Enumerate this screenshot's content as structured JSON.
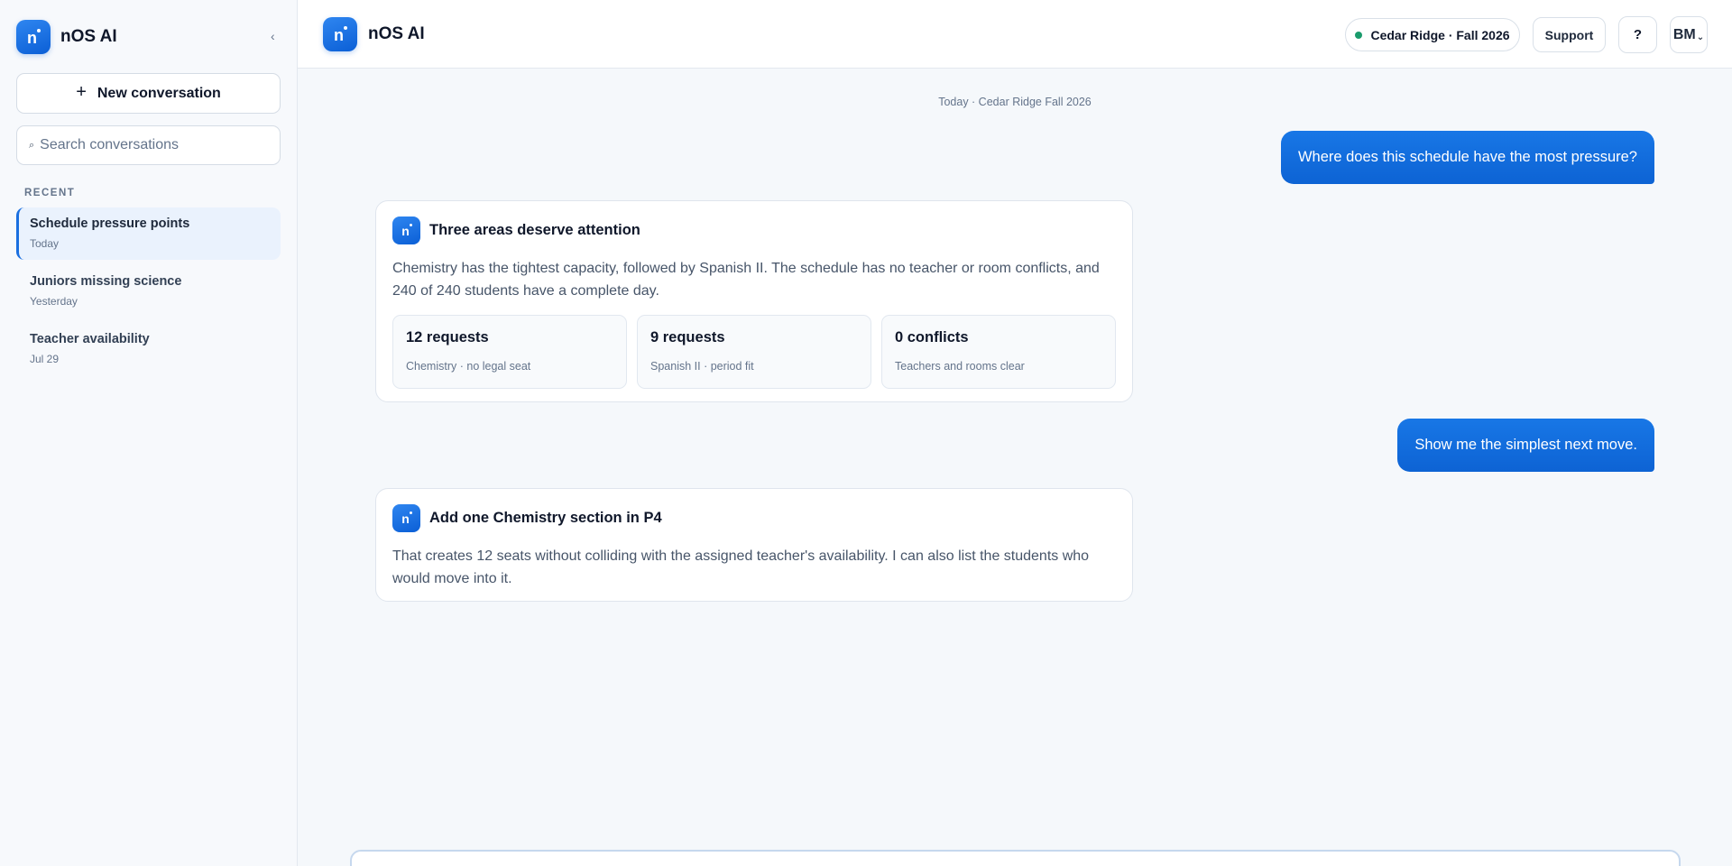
{
  "app": {
    "name": "nOS AI",
    "logo_letter": "n"
  },
  "sidebar": {
    "collapse_glyph": "‹",
    "new_conversation_label": "New conversation",
    "search_placeholder": "Search conversations",
    "section_label": "RECENT",
    "items": [
      {
        "title": "Schedule pressure points",
        "date": "Today",
        "active": true
      },
      {
        "title": "Juniors missing science",
        "date": "Yesterday",
        "active": false
      },
      {
        "title": "Teacher availability",
        "date": "Jul 29",
        "active": false
      }
    ]
  },
  "header": {
    "term_label": "Cedar Ridge · Fall 2026",
    "support_label": "Support",
    "help_label": "?",
    "avatar_initials": "BM",
    "status_color": "#1a9b6c"
  },
  "chat": {
    "day_label": "Today · Cedar Ridge Fall 2026",
    "messages": [
      {
        "role": "user",
        "text": "Where does this schedule have the most pressure?"
      },
      {
        "role": "assistant",
        "title": "Three areas deserve attention",
        "body": "Chemistry has the tightest capacity, followed by Spanish II. The schedule has no teacher or room conflicts, and 240 of 240 students have a complete day.",
        "stats": [
          {
            "value": "12 requests",
            "label": "Chemistry · no legal seat"
          },
          {
            "value": "9 requests",
            "label": "Spanish II · period fit"
          },
          {
            "value": "0 conflicts",
            "label": "Teachers and rooms clear"
          }
        ]
      },
      {
        "role": "user",
        "text": "Show me the simplest next move."
      },
      {
        "role": "assistant",
        "title": "Add one Chemistry section in P4",
        "body": "That creates 12 seats without colliding with the assigned teacher's availability. I can also list the students who would move into it."
      }
    ]
  },
  "colors": {
    "accent": "#0d63d4",
    "accent_light": "#eaf2fd"
  }
}
